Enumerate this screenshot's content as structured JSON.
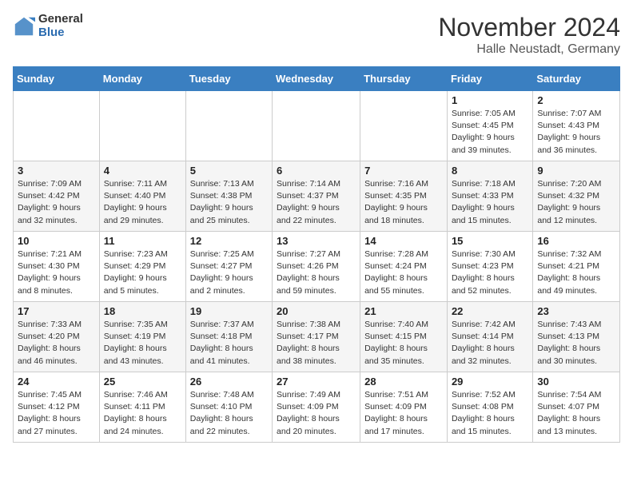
{
  "logo": {
    "general": "General",
    "blue": "Blue"
  },
  "header": {
    "month": "November 2024",
    "location": "Halle Neustadt, Germany"
  },
  "weekdays": [
    "Sunday",
    "Monday",
    "Tuesday",
    "Wednesday",
    "Thursday",
    "Friday",
    "Saturday"
  ],
  "weeks": [
    [
      {
        "day": "",
        "info": ""
      },
      {
        "day": "",
        "info": ""
      },
      {
        "day": "",
        "info": ""
      },
      {
        "day": "",
        "info": ""
      },
      {
        "day": "",
        "info": ""
      },
      {
        "day": "1",
        "info": "Sunrise: 7:05 AM\nSunset: 4:45 PM\nDaylight: 9 hours\nand 39 minutes."
      },
      {
        "day": "2",
        "info": "Sunrise: 7:07 AM\nSunset: 4:43 PM\nDaylight: 9 hours\nand 36 minutes."
      }
    ],
    [
      {
        "day": "3",
        "info": "Sunrise: 7:09 AM\nSunset: 4:42 PM\nDaylight: 9 hours\nand 32 minutes."
      },
      {
        "day": "4",
        "info": "Sunrise: 7:11 AM\nSunset: 4:40 PM\nDaylight: 9 hours\nand 29 minutes."
      },
      {
        "day": "5",
        "info": "Sunrise: 7:13 AM\nSunset: 4:38 PM\nDaylight: 9 hours\nand 25 minutes."
      },
      {
        "day": "6",
        "info": "Sunrise: 7:14 AM\nSunset: 4:37 PM\nDaylight: 9 hours\nand 22 minutes."
      },
      {
        "day": "7",
        "info": "Sunrise: 7:16 AM\nSunset: 4:35 PM\nDaylight: 9 hours\nand 18 minutes."
      },
      {
        "day": "8",
        "info": "Sunrise: 7:18 AM\nSunset: 4:33 PM\nDaylight: 9 hours\nand 15 minutes."
      },
      {
        "day": "9",
        "info": "Sunrise: 7:20 AM\nSunset: 4:32 PM\nDaylight: 9 hours\nand 12 minutes."
      }
    ],
    [
      {
        "day": "10",
        "info": "Sunrise: 7:21 AM\nSunset: 4:30 PM\nDaylight: 9 hours\nand 8 minutes."
      },
      {
        "day": "11",
        "info": "Sunrise: 7:23 AM\nSunset: 4:29 PM\nDaylight: 9 hours\nand 5 minutes."
      },
      {
        "day": "12",
        "info": "Sunrise: 7:25 AM\nSunset: 4:27 PM\nDaylight: 9 hours\nand 2 minutes."
      },
      {
        "day": "13",
        "info": "Sunrise: 7:27 AM\nSunset: 4:26 PM\nDaylight: 8 hours\nand 59 minutes."
      },
      {
        "day": "14",
        "info": "Sunrise: 7:28 AM\nSunset: 4:24 PM\nDaylight: 8 hours\nand 55 minutes."
      },
      {
        "day": "15",
        "info": "Sunrise: 7:30 AM\nSunset: 4:23 PM\nDaylight: 8 hours\nand 52 minutes."
      },
      {
        "day": "16",
        "info": "Sunrise: 7:32 AM\nSunset: 4:21 PM\nDaylight: 8 hours\nand 49 minutes."
      }
    ],
    [
      {
        "day": "17",
        "info": "Sunrise: 7:33 AM\nSunset: 4:20 PM\nDaylight: 8 hours\nand 46 minutes."
      },
      {
        "day": "18",
        "info": "Sunrise: 7:35 AM\nSunset: 4:19 PM\nDaylight: 8 hours\nand 43 minutes."
      },
      {
        "day": "19",
        "info": "Sunrise: 7:37 AM\nSunset: 4:18 PM\nDaylight: 8 hours\nand 41 minutes."
      },
      {
        "day": "20",
        "info": "Sunrise: 7:38 AM\nSunset: 4:17 PM\nDaylight: 8 hours\nand 38 minutes."
      },
      {
        "day": "21",
        "info": "Sunrise: 7:40 AM\nSunset: 4:15 PM\nDaylight: 8 hours\nand 35 minutes."
      },
      {
        "day": "22",
        "info": "Sunrise: 7:42 AM\nSunset: 4:14 PM\nDaylight: 8 hours\nand 32 minutes."
      },
      {
        "day": "23",
        "info": "Sunrise: 7:43 AM\nSunset: 4:13 PM\nDaylight: 8 hours\nand 30 minutes."
      }
    ],
    [
      {
        "day": "24",
        "info": "Sunrise: 7:45 AM\nSunset: 4:12 PM\nDaylight: 8 hours\nand 27 minutes."
      },
      {
        "day": "25",
        "info": "Sunrise: 7:46 AM\nSunset: 4:11 PM\nDaylight: 8 hours\nand 24 minutes."
      },
      {
        "day": "26",
        "info": "Sunrise: 7:48 AM\nSunset: 4:10 PM\nDaylight: 8 hours\nand 22 minutes."
      },
      {
        "day": "27",
        "info": "Sunrise: 7:49 AM\nSunset: 4:09 PM\nDaylight: 8 hours\nand 20 minutes."
      },
      {
        "day": "28",
        "info": "Sunrise: 7:51 AM\nSunset: 4:09 PM\nDaylight: 8 hours\nand 17 minutes."
      },
      {
        "day": "29",
        "info": "Sunrise: 7:52 AM\nSunset: 4:08 PM\nDaylight: 8 hours\nand 15 minutes."
      },
      {
        "day": "30",
        "info": "Sunrise: 7:54 AM\nSunset: 4:07 PM\nDaylight: 8 hours\nand 13 minutes."
      }
    ]
  ]
}
